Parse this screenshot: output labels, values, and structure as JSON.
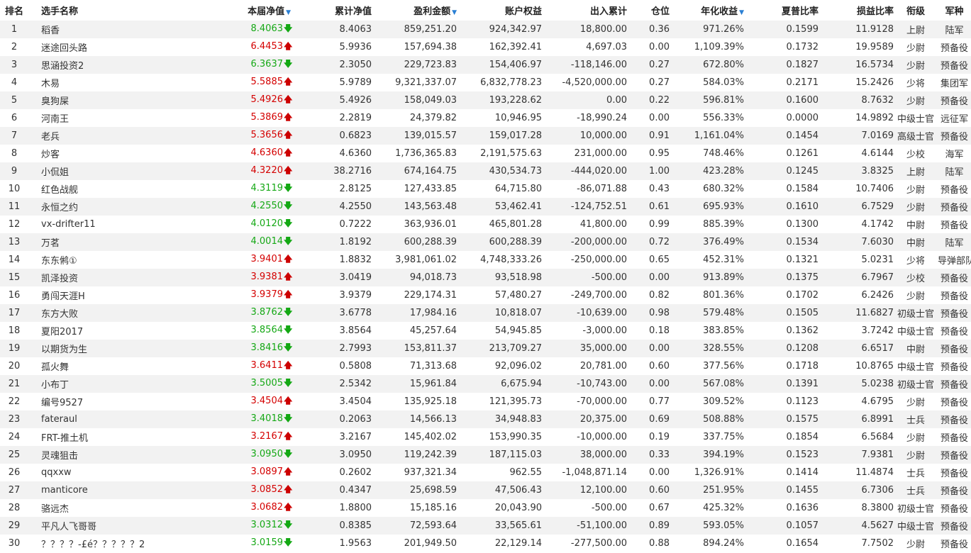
{
  "columns": {
    "rank": "排名",
    "name": "选手名称",
    "nav": "本届净值",
    "cum_nav": "累计净值",
    "pnl": "盈利金额",
    "equity": "账户权益",
    "flow": "出入累计",
    "position": "仓位",
    "annual": "年化收益",
    "sharpe": "夏普比率",
    "plr": "损益比率",
    "grade": "衔级",
    "branch": "军种"
  },
  "sort_icon": "▼",
  "arrow_glyphs": {
    "up": "🡅",
    "down": "🡇"
  },
  "colors": {
    "up": "#d40000",
    "down": "#15a815",
    "sort": "#2a7fd4"
  },
  "rows": [
    {
      "rank": "1",
      "name": "稻香",
      "nav": "8.4063",
      "dir": "down",
      "cum_nav": "8.4063",
      "pnl": "859,251.20",
      "equity": "924,342.97",
      "flow": "18,800.00",
      "position": "0.36",
      "annual": "971.26%",
      "sharpe": "0.1599",
      "plr": "11.9128",
      "grade": "上尉",
      "branch": "陆军"
    },
    {
      "rank": "2",
      "name": "迷途回头路",
      "nav": "6.4453",
      "dir": "up",
      "cum_nav": "5.9936",
      "pnl": "157,694.38",
      "equity": "162,392.41",
      "flow": "4,697.03",
      "position": "0.00",
      "annual": "1,109.39%",
      "sharpe": "0.1732",
      "plr": "19.9589",
      "grade": "少尉",
      "branch": "预备役"
    },
    {
      "rank": "3",
      "name": "思涵投资2",
      "nav": "6.3637",
      "dir": "down",
      "cum_nav": "2.3050",
      "pnl": "229,723.83",
      "equity": "154,406.97",
      "flow": "-118,146.00",
      "position": "0.27",
      "annual": "672.80%",
      "sharpe": "0.1827",
      "plr": "16.5734",
      "grade": "少尉",
      "branch": "预备役"
    },
    {
      "rank": "4",
      "name": "木易",
      "nav": "5.5885",
      "dir": "up",
      "cum_nav": "5.9789",
      "pnl": "9,321,337.07",
      "equity": "6,832,778.23",
      "flow": "-4,520,000.00",
      "position": "0.27",
      "annual": "584.03%",
      "sharpe": "0.2171",
      "plr": "15.2426",
      "grade": "少将",
      "branch": "集团军"
    },
    {
      "rank": "5",
      "name": "臭狗屎",
      "nav": "5.4926",
      "dir": "up",
      "cum_nav": "5.4926",
      "pnl": "158,049.03",
      "equity": "193,228.62",
      "flow": "0.00",
      "position": "0.22",
      "annual": "596.81%",
      "sharpe": "0.1600",
      "plr": "8.7632",
      "grade": "少尉",
      "branch": "预备役"
    },
    {
      "rank": "6",
      "name": "河南王",
      "nav": "5.3869",
      "dir": "up",
      "cum_nav": "2.2819",
      "pnl": "24,379.82",
      "equity": "10,946.95",
      "flow": "-18,990.24",
      "position": "0.00",
      "annual": "556.33%",
      "sharpe": "0.0000",
      "plr": "14.9892",
      "grade": "中级士官",
      "branch": "远征军"
    },
    {
      "rank": "7",
      "name": "老兵",
      "nav": "5.3656",
      "dir": "up",
      "cum_nav": "0.6823",
      "pnl": "139,015.57",
      "equity": "159,017.28",
      "flow": "10,000.00",
      "position": "0.91",
      "annual": "1,161.04%",
      "sharpe": "0.1454",
      "plr": "7.0169",
      "grade": "高级士官",
      "branch": "预备役"
    },
    {
      "rank": "8",
      "name": "炒客",
      "nav": "4.6360",
      "dir": "up",
      "cum_nav": "4.6360",
      "pnl": "1,736,365.83",
      "equity": "2,191,575.63",
      "flow": "231,000.00",
      "position": "0.95",
      "annual": "748.46%",
      "sharpe": "0.1261",
      "plr": "4.6144",
      "grade": "少校",
      "branch": "海军"
    },
    {
      "rank": "9",
      "name": "小侃姐",
      "nav": "4.3220",
      "dir": "up",
      "cum_nav": "38.2716",
      "pnl": "674,164.75",
      "equity": "430,534.73",
      "flow": "-444,020.00",
      "position": "1.00",
      "annual": "423.28%",
      "sharpe": "0.1245",
      "plr": "3.8325",
      "grade": "上尉",
      "branch": "陆军"
    },
    {
      "rank": "10",
      "name": "红色战舰",
      "nav": "4.3119",
      "dir": "down",
      "cum_nav": "2.8125",
      "pnl": "127,433.85",
      "equity": "64,715.80",
      "flow": "-86,071.88",
      "position": "0.43",
      "annual": "680.32%",
      "sharpe": "0.1584",
      "plr": "10.7406",
      "grade": "少尉",
      "branch": "预备役"
    },
    {
      "rank": "11",
      "name": "永恒之约",
      "nav": "4.2550",
      "dir": "down",
      "cum_nav": "4.2550",
      "pnl": "143,563.48",
      "equity": "53,462.41",
      "flow": "-124,752.51",
      "position": "0.61",
      "annual": "695.93%",
      "sharpe": "0.1610",
      "plr": "6.7529",
      "grade": "少尉",
      "branch": "预备役"
    },
    {
      "rank": "12",
      "name": "vx-drifter11",
      "nav": "4.0120",
      "dir": "down",
      "cum_nav": "0.7222",
      "pnl": "363,936.01",
      "equity": "465,801.28",
      "flow": "41,800.00",
      "position": "0.99",
      "annual": "885.39%",
      "sharpe": "0.1300",
      "plr": "4.1742",
      "grade": "中尉",
      "branch": "预备役"
    },
    {
      "rank": "13",
      "name": "万茗",
      "nav": "4.0014",
      "dir": "down",
      "cum_nav": "1.8192",
      "pnl": "600,288.39",
      "equity": "600,288.39",
      "flow": "-200,000.00",
      "position": "0.72",
      "annual": "376.49%",
      "sharpe": "0.1534",
      "plr": "7.6030",
      "grade": "中尉",
      "branch": "陆军"
    },
    {
      "rank": "14",
      "name": "东东鸺①",
      "nav": "3.9401",
      "dir": "up",
      "cum_nav": "1.8832",
      "pnl": "3,981,061.02",
      "equity": "4,748,333.26",
      "flow": "-250,000.00",
      "position": "0.65",
      "annual": "452.31%",
      "sharpe": "0.1321",
      "plr": "5.0231",
      "grade": "少将",
      "branch": "导弹部队"
    },
    {
      "rank": "15",
      "name": "凯泽投资",
      "nav": "3.9381",
      "dir": "up",
      "cum_nav": "3.0419",
      "pnl": "94,018.73",
      "equity": "93,518.98",
      "flow": "-500.00",
      "position": "0.00",
      "annual": "913.89%",
      "sharpe": "0.1375",
      "plr": "6.7967",
      "grade": "少校",
      "branch": "预备役"
    },
    {
      "rank": "16",
      "name": "勇闯天涯H",
      "nav": "3.9379",
      "dir": "up",
      "cum_nav": "3.9379",
      "pnl": "229,174.31",
      "equity": "57,480.27",
      "flow": "-249,700.00",
      "position": "0.82",
      "annual": "801.36%",
      "sharpe": "0.1702",
      "plr": "6.2426",
      "grade": "少尉",
      "branch": "预备役"
    },
    {
      "rank": "17",
      "name": "东方大败",
      "nav": "3.8762",
      "dir": "down",
      "cum_nav": "3.6778",
      "pnl": "17,984.16",
      "equity": "10,818.07",
      "flow": "-10,639.00",
      "position": "0.98",
      "annual": "579.48%",
      "sharpe": "0.1505",
      "plr": "11.6827",
      "grade": "初级士官",
      "branch": "预备役"
    },
    {
      "rank": "18",
      "name": "夏阳2017",
      "nav": "3.8564",
      "dir": "down",
      "cum_nav": "3.8564",
      "pnl": "45,257.64",
      "equity": "54,945.85",
      "flow": "-3,000.00",
      "position": "0.18",
      "annual": "383.85%",
      "sharpe": "0.1362",
      "plr": "3.7242",
      "grade": "中级士官",
      "branch": "预备役"
    },
    {
      "rank": "19",
      "name": "以期货为生",
      "nav": "3.8416",
      "dir": "down",
      "cum_nav": "2.7993",
      "pnl": "153,811.37",
      "equity": "213,709.27",
      "flow": "35,000.00",
      "position": "0.00",
      "annual": "328.55%",
      "sharpe": "0.1208",
      "plr": "6.6517",
      "grade": "中尉",
      "branch": "预备役"
    },
    {
      "rank": "20",
      "name": "孤火舞",
      "nav": "3.6411",
      "dir": "up",
      "cum_nav": "0.5808",
      "pnl": "71,313.68",
      "equity": "92,096.02",
      "flow": "20,781.00",
      "position": "0.60",
      "annual": "377.56%",
      "sharpe": "0.1718",
      "plr": "10.8765",
      "grade": "中级士官",
      "branch": "预备役"
    },
    {
      "rank": "21",
      "name": "小布丁",
      "nav": "3.5005",
      "dir": "down",
      "cum_nav": "2.5342",
      "pnl": "15,961.84",
      "equity": "6,675.94",
      "flow": "-10,743.00",
      "position": "0.00",
      "annual": "567.08%",
      "sharpe": "0.1391",
      "plr": "5.0238",
      "grade": "初级士官",
      "branch": "预备役"
    },
    {
      "rank": "22",
      "name": "编号9527",
      "nav": "3.4504",
      "dir": "up",
      "cum_nav": "3.4504",
      "pnl": "135,925.18",
      "equity": "121,395.73",
      "flow": "-70,000.00",
      "position": "0.77",
      "annual": "309.52%",
      "sharpe": "0.1123",
      "plr": "4.6795",
      "grade": "少尉",
      "branch": "预备役"
    },
    {
      "rank": "23",
      "name": "fateraul",
      "nav": "3.4018",
      "dir": "down",
      "cum_nav": "0.2063",
      "pnl": "14,566.13",
      "equity": "34,948.83",
      "flow": "20,375.00",
      "position": "0.69",
      "annual": "508.88%",
      "sharpe": "0.1575",
      "plr": "6.8991",
      "grade": "士兵",
      "branch": "预备役"
    },
    {
      "rank": "24",
      "name": "FRT-推土机",
      "nav": "3.2167",
      "dir": "up",
      "cum_nav": "3.2167",
      "pnl": "145,402.02",
      "equity": "153,990.35",
      "flow": "-10,000.00",
      "position": "0.19",
      "annual": "337.75%",
      "sharpe": "0.1854",
      "plr": "6.5684",
      "grade": "少尉",
      "branch": "预备役"
    },
    {
      "rank": "25",
      "name": "灵魂狙击",
      "nav": "3.0950",
      "dir": "down",
      "cum_nav": "3.0950",
      "pnl": "119,242.39",
      "equity": "187,115.03",
      "flow": "38,000.00",
      "position": "0.33",
      "annual": "394.19%",
      "sharpe": "0.1523",
      "plr": "7.9381",
      "grade": "少尉",
      "branch": "预备役"
    },
    {
      "rank": "26",
      "name": "qqxxw",
      "nav": "3.0897",
      "dir": "up",
      "cum_nav": "0.2602",
      "pnl": "937,321.34",
      "equity": "962.55",
      "flow": "-1,048,871.14",
      "position": "0.00",
      "annual": "1,326.91%",
      "sharpe": "0.1414",
      "plr": "11.4874",
      "grade": "士兵",
      "branch": "预备役"
    },
    {
      "rank": "27",
      "name": "manticore",
      "nav": "3.0852",
      "dir": "up",
      "cum_nav": "0.4347",
      "pnl": "25,698.59",
      "equity": "47,506.43",
      "flow": "12,100.00",
      "position": "0.60",
      "annual": "251.95%",
      "sharpe": "0.1455",
      "plr": "6.7306",
      "grade": "士兵",
      "branch": "预备役"
    },
    {
      "rank": "28",
      "name": "骆远杰",
      "nav": "3.0682",
      "dir": "up",
      "cum_nav": "1.8800",
      "pnl": "15,185.16",
      "equity": "20,043.90",
      "flow": "-500.00",
      "position": "0.67",
      "annual": "425.32%",
      "sharpe": "0.1636",
      "plr": "8.3800",
      "grade": "初级士官",
      "branch": "预备役"
    },
    {
      "rank": "29",
      "name": "平凡人飞哥哥",
      "nav": "3.0312",
      "dir": "down",
      "cum_nav": "0.8385",
      "pnl": "72,593.64",
      "equity": "33,565.61",
      "flow": "-51,100.00",
      "position": "0.89",
      "annual": "593.05%",
      "sharpe": "0.1057",
      "plr": "4.5627",
      "grade": "中级士官",
      "branch": "预备役"
    },
    {
      "rank": "30",
      "name": "？？？？-£é？？？？？2",
      "nav": "3.0159",
      "dir": "down",
      "cum_nav": "1.9563",
      "pnl": "201,949.50",
      "equity": "22,129.14",
      "flow": "-277,500.00",
      "position": "0.88",
      "annual": "894.24%",
      "sharpe": "0.1654",
      "plr": "7.7502",
      "grade": "少尉",
      "branch": "预备役"
    }
  ]
}
